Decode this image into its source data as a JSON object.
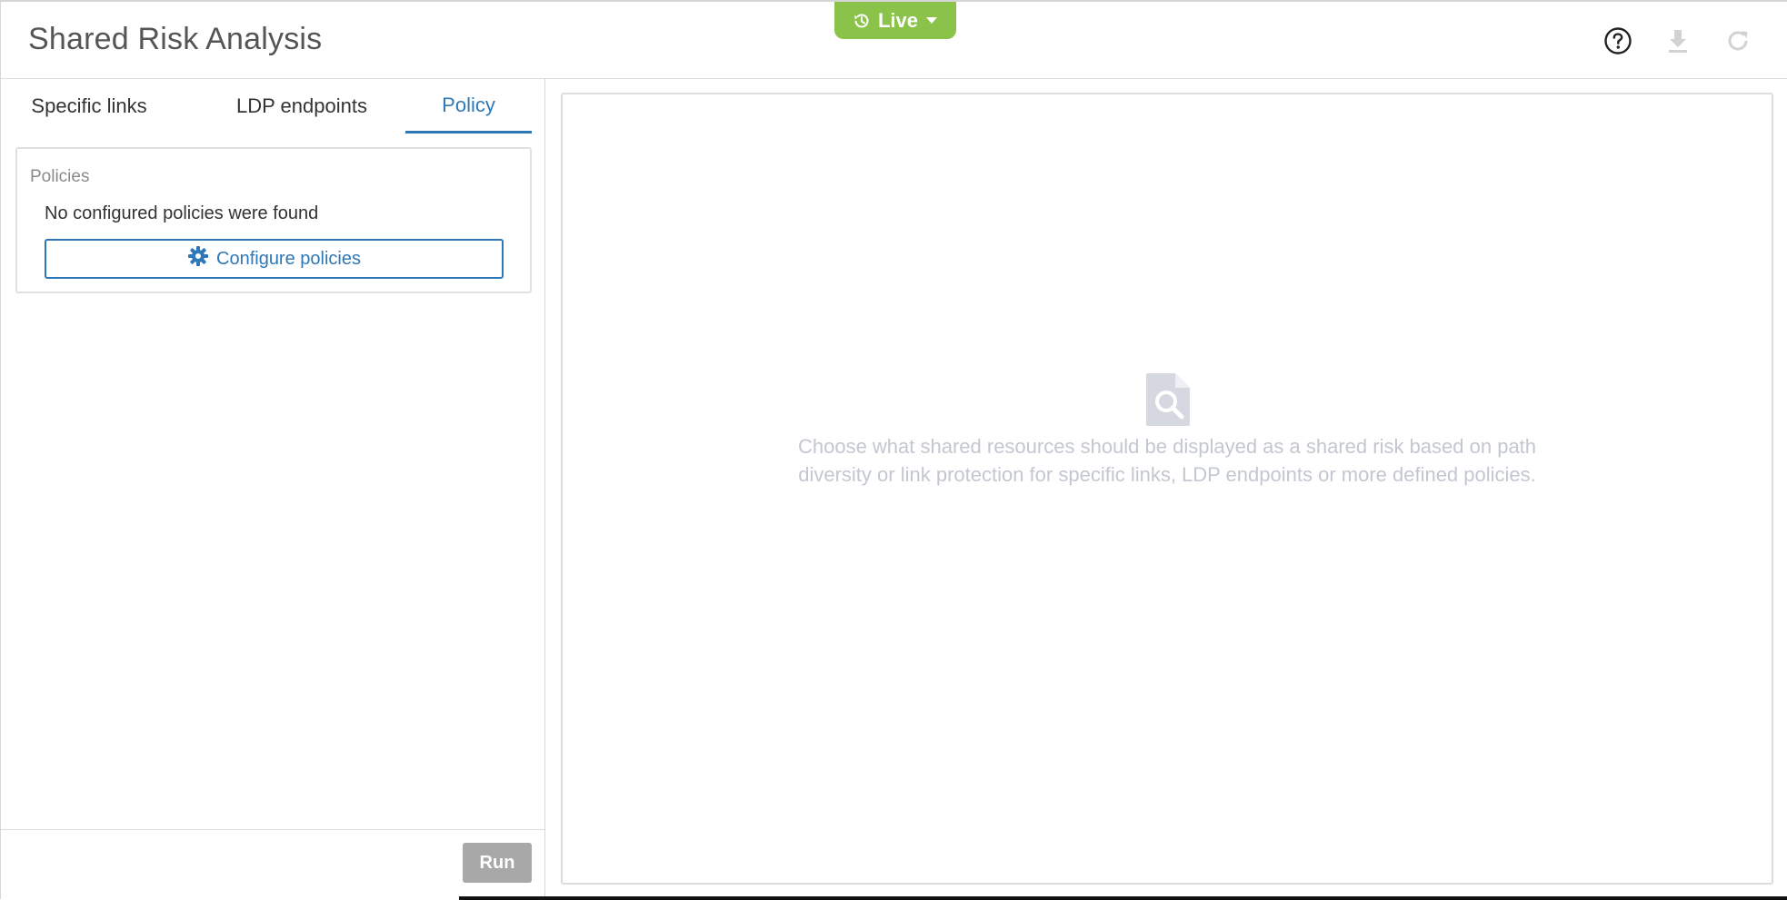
{
  "header": {
    "title": "Shared Risk Analysis",
    "live_label": "Live",
    "icons": [
      "history-icon",
      "caret-down-icon",
      "help-icon",
      "download-icon",
      "refresh-icon"
    ]
  },
  "tabs": [
    {
      "label": "Specific links",
      "active": false
    },
    {
      "label": "LDP endpoints",
      "active": false
    },
    {
      "label": "Policy",
      "active": true
    }
  ],
  "policies": {
    "section_label": "Policies",
    "empty_text": "No configured policies were found",
    "configure_label": "Configure policies"
  },
  "footer": {
    "run_label": "Run"
  },
  "empty_state": {
    "line1": "Choose what shared resources should be displayed as a shared risk based on path",
    "line2": "diversity or link protection for specific links, LDP endpoints or more defined policies."
  },
  "colors": {
    "accent": "#2f78b7",
    "live": "#8bc34a",
    "disabled": "#a8a8a8",
    "muted_text": "#c3c7d0"
  }
}
